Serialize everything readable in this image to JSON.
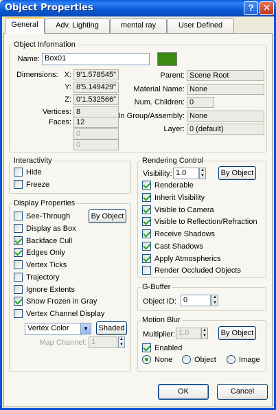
{
  "window": {
    "title": "Object Properties",
    "help_glyph": "?",
    "close_glyph": "✕"
  },
  "tabs": [
    "General",
    "Adv. Lighting",
    "mental ray",
    "User Defined"
  ],
  "object_info": {
    "group_label": "Object Information",
    "name_label": "Name:",
    "name_value": "Box01",
    "color_swatch": "#3a8a14",
    "dimensions_label": "Dimensions:",
    "x_label": "X:",
    "x_value": "9'1.578545\"",
    "y_label": "Y:",
    "y_value": "8'5.149429\"",
    "z_label": "Z:",
    "z_value": "0'1.532566\"",
    "vertices_label": "Vertices:",
    "vertices_value": "8",
    "faces_label": "Faces:",
    "faces_value": "12",
    "extra1": "0",
    "extra2": "0",
    "parent_label": "Parent:",
    "parent_value": "Scene Root",
    "material_label": "Material Name:",
    "material_value": "None",
    "children_label": "Num. Children:",
    "children_value": "0",
    "group_assembly_label": "In Group/Assembly:",
    "group_assembly_value": "None",
    "layer_label": "Layer:",
    "layer_value": "0 (default)"
  },
  "interactivity": {
    "group_label": "Interactivity",
    "hide": {
      "label": "Hide",
      "checked": false
    },
    "freeze": {
      "label": "Freeze",
      "checked": false
    }
  },
  "display": {
    "group_label": "Display Properties",
    "by_object": "By Object",
    "items": [
      {
        "label": "See-Through",
        "checked": false
      },
      {
        "label": "Display as Box",
        "checked": false
      },
      {
        "label": "Backface Cull",
        "checked": true
      },
      {
        "label": "Edges Only",
        "checked": true
      },
      {
        "label": "Vertex Ticks",
        "checked": false
      },
      {
        "label": "Trajectory",
        "checked": false
      },
      {
        "label": "Ignore Extents",
        "checked": false
      },
      {
        "label": "Show Frozen in Gray",
        "checked": true
      },
      {
        "label": "Vertex Channel Display",
        "checked": false
      }
    ],
    "vertex_color": "Vertex Color",
    "shaded": "Shaded",
    "map_channel_label": "Map Channel:",
    "map_channel_value": "1"
  },
  "rendering": {
    "group_label": "Rendering Control",
    "visibility_label": "Visibility:",
    "visibility_value": "1.0",
    "by_object": "By Object",
    "items": [
      {
        "label": "Renderable",
        "checked": true
      },
      {
        "label": "Inherit Visibility",
        "checked": true
      },
      {
        "label": "Visible to Camera",
        "checked": true
      },
      {
        "label": "Visible to Reflection/Refraction",
        "checked": true
      },
      {
        "label": "Receive Shadows",
        "checked": true
      },
      {
        "label": "Cast Shadows",
        "checked": true
      },
      {
        "label": "Apply Atmospherics",
        "checked": true
      },
      {
        "label": "Render Occluded Objects",
        "checked": false
      }
    ]
  },
  "gbuffer": {
    "group_label": "G-Buffer",
    "object_id_label": "Object ID:",
    "object_id_value": "0"
  },
  "motion_blur": {
    "group_label": "Motion Blur",
    "multiplier_label": "Multiplier:",
    "multiplier_value": "1.0",
    "by_object": "By Object",
    "enabled": {
      "label": "Enabled",
      "checked": true
    },
    "options": [
      {
        "label": "None",
        "selected": true
      },
      {
        "label": "Object",
        "selected": false
      },
      {
        "label": "Image",
        "selected": false
      }
    ]
  },
  "footer": {
    "ok": "OK",
    "cancel": "Cancel"
  }
}
